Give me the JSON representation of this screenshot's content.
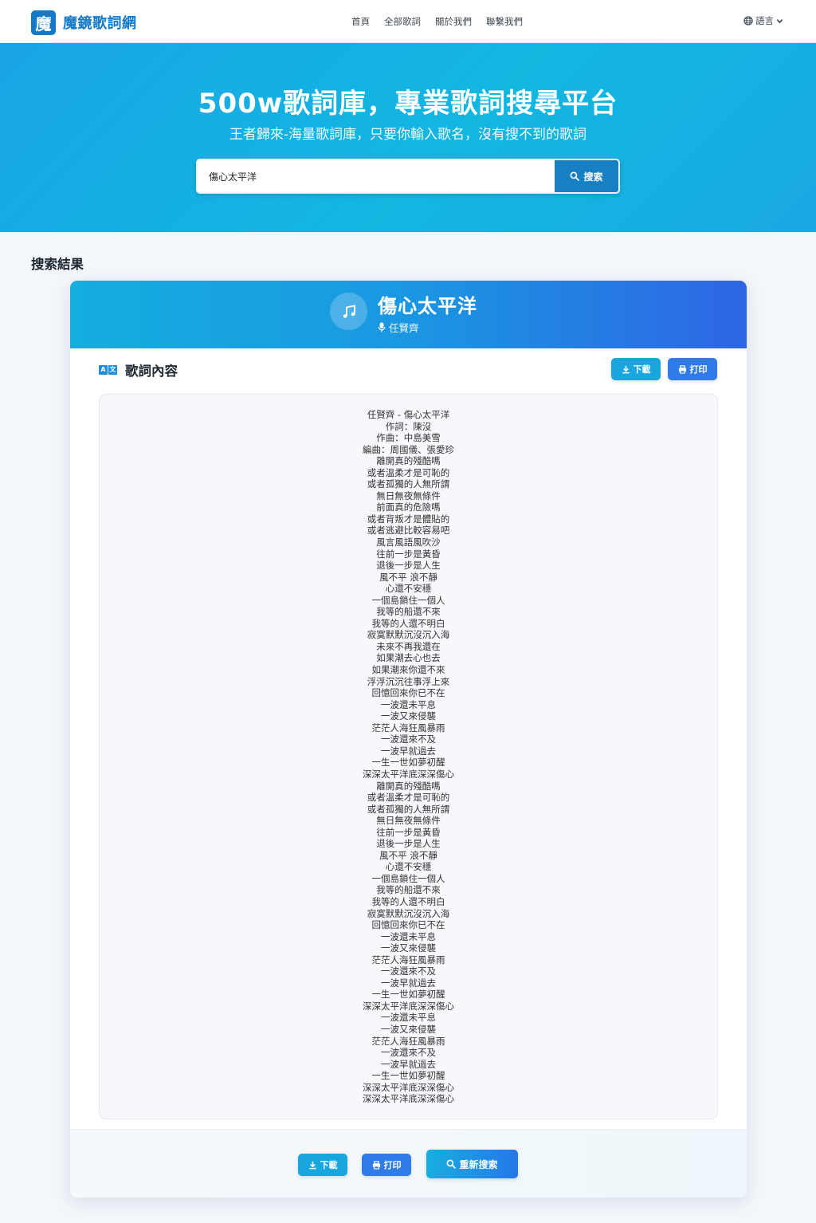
{
  "brand": {
    "logo_char": "魔",
    "name": "魔鏡歌詞網"
  },
  "nav": {
    "items": [
      "首頁",
      "全部歌詞",
      "關於我們",
      "聯繫我們"
    ]
  },
  "language": {
    "label": "語言"
  },
  "hero": {
    "title": "500w歌詞庫，專業歌詞搜尋平台",
    "subtitle": "王者歸來-海量歌詞庫，只要你輸入歌名，沒有搜不到的歌詞"
  },
  "search": {
    "value": "傷心太平洋",
    "button_label": "搜索"
  },
  "results": {
    "title": "搜索結果",
    "song_title": "傷心太平洋",
    "artist": "任賢齊",
    "lyrics_label": "歌詞內容",
    "lyrics_icon": [
      "A",
      "文"
    ],
    "download_label": "下載",
    "print_label": "打印",
    "research_label": "重新搜索",
    "lyrics": [
      "任賢齊 - 傷心太平洋",
      "作詞：陳沒",
      "作曲：中島美雪",
      "編曲：周國儀、張愛珍",
      "離開真的殘酷嗎",
      "或者溫柔才是可恥的",
      "或者孤獨的人無所謂",
      "無日無夜無條件",
      "前面真的危險嗎",
      "或者背叛才是體貼的",
      "或者逃避比較容易吧",
      "風言風語風吹沙",
      "往前一步是黃昏",
      "退後一步是人生",
      "風不平 浪不靜",
      "心還不安穩",
      "一個島鎖住一個人",
      "我等的船還不來",
      "我等的人還不明白",
      "寂寞默默沉沒沉入海",
      "未來不再我還在",
      "如果潮去心也去",
      "如果潮來你還不來",
      "浮浮沉沉往事浮上來",
      "回憶回來你已不在",
      "一波還未平息",
      "一波又來侵襲",
      "茫茫人海狂風暴雨",
      "一波還來不及",
      "一波早就過去",
      "一生一世如夢初醒",
      "深深太平洋底深深傷心",
      "離開真的殘酷嗎",
      "或者溫柔才是可恥的",
      "或者孤獨的人無所謂",
      "無日無夜無條件",
      "往前一步是黃昏",
      "退後一步是人生",
      "風不平 浪不靜",
      "心還不安穩",
      "一個島鎖住一個人",
      "我等的船還不來",
      "我等的人還不明白",
      "寂寞默默沉沒沉入海",
      "回憶回來你已不在",
      "一波還未平息",
      "一波又來侵襲",
      "茫茫人海狂風暴雨",
      "一波還來不及",
      "一波早就過去",
      "一生一世如夢初醒",
      "深深太平洋底深深傷心",
      "一波還未平息",
      "一波又來侵襲",
      "茫茫人海狂風暴雨",
      "一波還來不及",
      "一波早就過去",
      "一生一世如夢初醒",
      "深深太平洋底深深傷心",
      "深深太平洋底深深傷心"
    ]
  },
  "icons": {
    "globe": "globe-icon",
    "chevron": "chevron-down-icon",
    "search": "search-icon",
    "music": "music-note-icon",
    "mic": "microphone-icon",
    "translate": "translate-icon",
    "download": "download-icon",
    "print": "print-icon"
  },
  "colors": {
    "brand": "#1479c9",
    "hero": "#12b7e0",
    "search_button": "#1581c4",
    "download_button": "#19a6df",
    "print_button": "#2f7be7"
  }
}
